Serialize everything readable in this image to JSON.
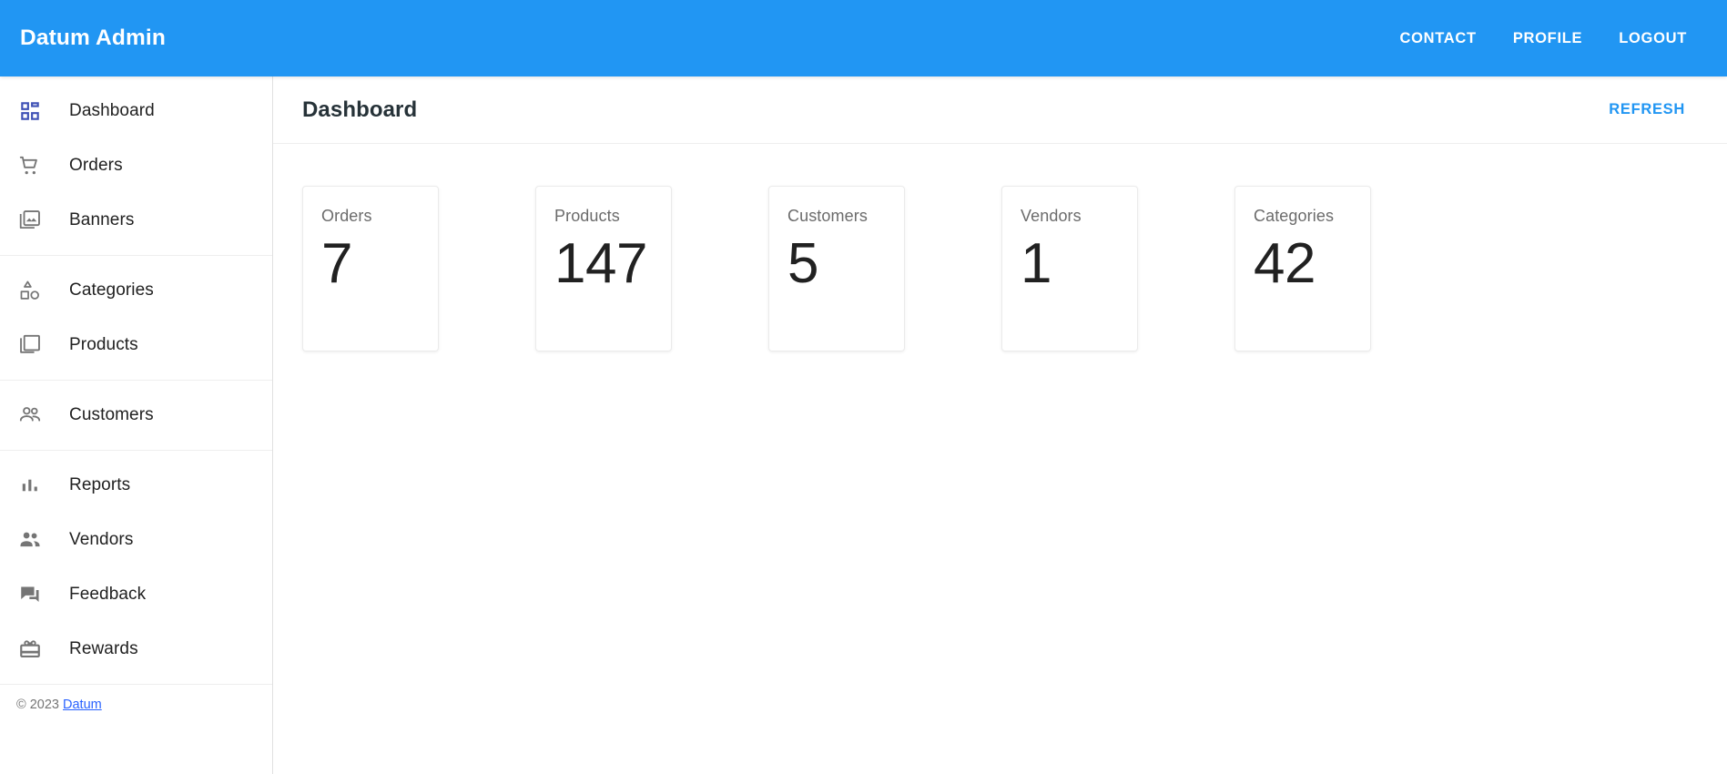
{
  "appbar": {
    "brand": "Datum Admin",
    "links": [
      {
        "label": "CONTACT",
        "name": "contact"
      },
      {
        "label": "PROFILE",
        "name": "profile"
      },
      {
        "label": "LOGOUT",
        "name": "logout"
      }
    ]
  },
  "colors": {
    "appbar_blue": "#2196f3",
    "accent_link": "#2196f3",
    "active_icon_indigo": "#3f51b5",
    "footer_link_blue": "#2962ff",
    "icon_grey": "#757575",
    "text_primary": "#212121",
    "border_grey": "#e0e0e0"
  },
  "sidebar": {
    "groups": [
      {
        "items": [
          {
            "label": "Dashboard",
            "icon": "dashboard-icon",
            "active": true
          },
          {
            "label": "Orders",
            "icon": "shopping-cart-icon",
            "active": false
          },
          {
            "label": "Banners",
            "icon": "photo-library-icon",
            "active": false
          }
        ]
      },
      {
        "items": [
          {
            "label": "Categories",
            "icon": "category-shapes-icon",
            "active": false
          },
          {
            "label": "Products",
            "icon": "layers-copy-icon",
            "active": false
          }
        ]
      },
      {
        "items": [
          {
            "label": "Customers",
            "icon": "people-outline-icon",
            "active": false
          }
        ]
      },
      {
        "items": [
          {
            "label": "Reports",
            "icon": "bar-chart-icon",
            "active": false
          },
          {
            "label": "Vendors",
            "icon": "people-filled-icon",
            "active": false
          },
          {
            "label": "Feedback",
            "icon": "comment-bubbles-icon",
            "active": false
          },
          {
            "label": "Rewards",
            "icon": "card-giftcard-icon",
            "active": false
          }
        ]
      }
    ],
    "footer": {
      "copyright": "© 2023",
      "link_label": "Datum"
    }
  },
  "main": {
    "page_title": "Dashboard",
    "refresh_label": "REFRESH",
    "stat_cards": [
      {
        "label": "Orders",
        "value": "7"
      },
      {
        "label": "Products",
        "value": "147"
      },
      {
        "label": "Customers",
        "value": "5"
      },
      {
        "label": "Vendors",
        "value": "1"
      },
      {
        "label": "Categories",
        "value": "42"
      }
    ]
  }
}
